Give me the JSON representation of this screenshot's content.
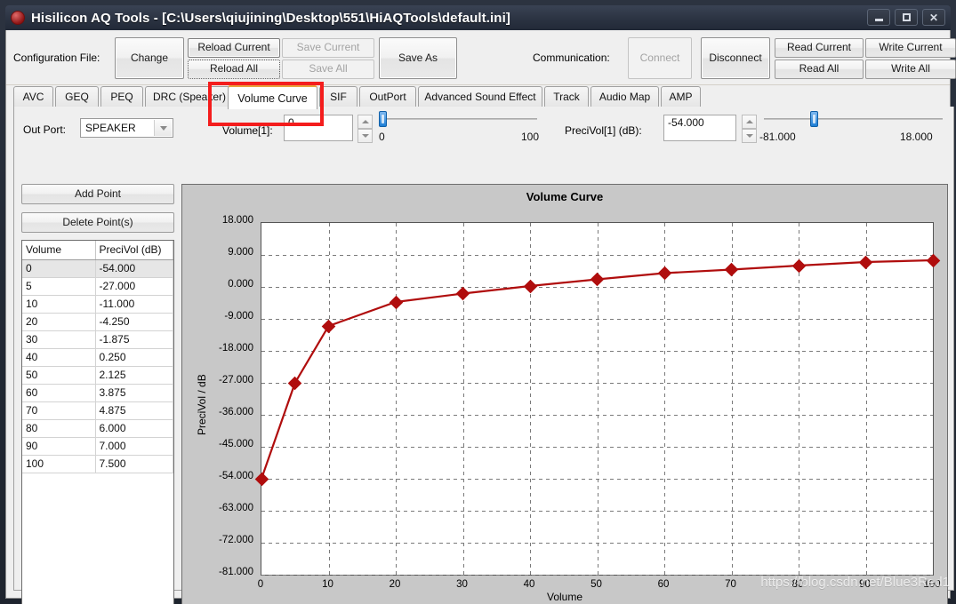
{
  "window": {
    "title": "Hisilicon AQ Tools - [C:\\Users\\qiujining\\Desktop\\551\\HiAQTools\\default.ini]",
    "icon": "app-icon",
    "minimize": "–",
    "maximize": "□",
    "close": "✕"
  },
  "toolbar": {
    "config_label": "Configuration File:",
    "change": "Change",
    "reload_current": "Reload Current",
    "reload_all": "Reload All",
    "save_current": "Save Current",
    "save_all": "Save All",
    "save_as": "Save As",
    "communication_label": "Communication:",
    "connect": "Connect",
    "disconnect": "Disconnect",
    "read_current": "Read Current",
    "read_all": "Read All",
    "write_current": "Write Current",
    "write_all": "Write All"
  },
  "tabs": [
    {
      "label": "AVC",
      "active": false
    },
    {
      "label": "GEQ",
      "active": false
    },
    {
      "label": "PEQ",
      "active": false
    },
    {
      "label": "DRC (Speaker)",
      "active": false
    },
    {
      "label": "Volume Curve",
      "active": true
    },
    {
      "label": "SIF",
      "active": false
    },
    {
      "label": "OutPort",
      "active": false
    },
    {
      "label": "Advanced Sound Effect",
      "active": false
    },
    {
      "label": "Track",
      "active": false
    },
    {
      "label": "Audio Map",
      "active": false
    },
    {
      "label": "AMP",
      "active": false
    }
  ],
  "controls": {
    "out_port_label": "Out Port:",
    "out_port_value": "SPEAKER",
    "volume_label": "Volume[1]:",
    "volume_value": "0",
    "volume_min": "0",
    "volume_max": "100",
    "volume_slider_pct": 0,
    "precivol_label": "PreciVol[1] (dB):",
    "precivol_value": "-54.000",
    "precivol_min": "-81.000",
    "precivol_max": "18.000",
    "precivol_slider_pct": 27.3
  },
  "actions": {
    "add_point": "Add Point",
    "delete_points": "Delete Point(s)"
  },
  "table": {
    "columns": [
      "Volume",
      "PreciVol (dB)"
    ],
    "rows": [
      [
        "0",
        "-54.000"
      ],
      [
        "5",
        "-27.000"
      ],
      [
        "10",
        "-11.000"
      ],
      [
        "20",
        "-4.250"
      ],
      [
        "30",
        "-1.875"
      ],
      [
        "40",
        "0.250"
      ],
      [
        "50",
        "2.125"
      ],
      [
        "60",
        "3.875"
      ],
      [
        "70",
        "4.875"
      ],
      [
        "80",
        "6.000"
      ],
      [
        "90",
        "7.000"
      ],
      [
        "100",
        "7.500"
      ]
    ],
    "selected_row": 0
  },
  "chart_data": {
    "type": "line",
    "title": "Volume Curve",
    "xlabel": "Volume",
    "ylabel": "PreciVol / dB",
    "x": [
      0,
      5,
      10,
      20,
      30,
      40,
      50,
      60,
      70,
      80,
      90,
      100
    ],
    "values": [
      -54.0,
      -27.0,
      -11.0,
      -4.25,
      -1.875,
      0.25,
      2.125,
      3.875,
      4.875,
      6.0,
      7.0,
      7.5
    ],
    "xlim": [
      0,
      100
    ],
    "ylim": [
      -81,
      18
    ],
    "xticks": [
      0,
      10,
      20,
      30,
      40,
      50,
      60,
      70,
      80,
      90,
      100
    ],
    "xticklabels": [
      "0",
      "10",
      "20",
      "30",
      "40",
      "50",
      "60",
      "70",
      "80",
      "90",
      "100"
    ],
    "yticks": [
      18,
      9,
      0,
      -9,
      -18,
      -27,
      -36,
      -45,
      -54,
      -63,
      -72,
      -81
    ],
    "yticklabels": [
      "18.000",
      "9.000",
      "0.000",
      "-9.000",
      "-18.000",
      "-27.000",
      "-36.000",
      "-45.000",
      "-54.000",
      "-63.000",
      "-72.000",
      "-81.000"
    ],
    "grid": true,
    "legend": null,
    "series_color": "#b00d0d",
    "marker": "diamond"
  },
  "watermark": "https://blog.csdn.net/Blue3Red1"
}
